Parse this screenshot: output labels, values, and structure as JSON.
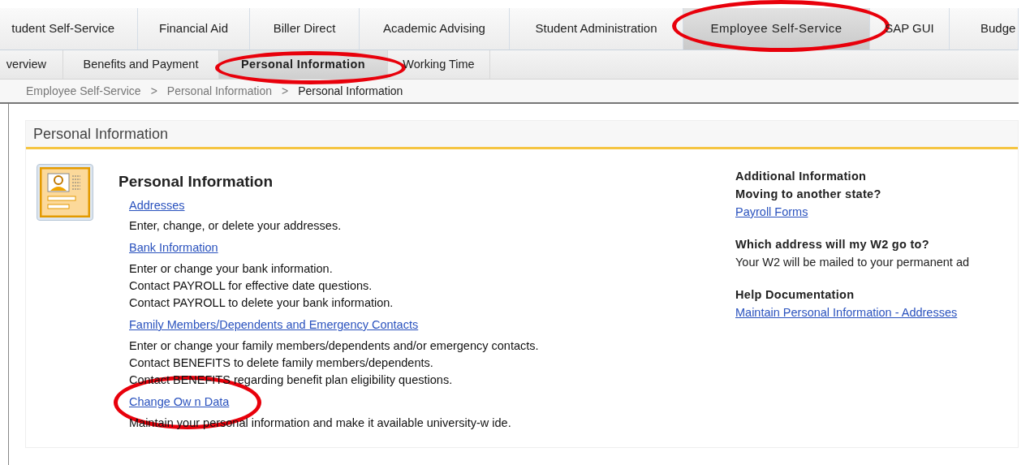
{
  "top_tabs": [
    {
      "label": "tudent Self-Service",
      "selected": false,
      "circled": false
    },
    {
      "label": "Financial Aid",
      "selected": false,
      "circled": false
    },
    {
      "label": "Biller Direct",
      "selected": false,
      "circled": false
    },
    {
      "label": "Academic Advising",
      "selected": false,
      "circled": false
    },
    {
      "label": "Student Administration",
      "selected": false,
      "circled": false
    },
    {
      "label": "Employee Self-Service",
      "selected": true,
      "circled": true
    },
    {
      "label": "SAP GUI",
      "selected": false,
      "circled": false
    },
    {
      "label": "Budge",
      "selected": false,
      "circled": false
    }
  ],
  "sub_tabs": [
    {
      "label": "verview",
      "selected": false,
      "circled": false
    },
    {
      "label": "Benefits and Payment",
      "selected": false,
      "circled": false
    },
    {
      "label": "Personal Information",
      "selected": true,
      "circled": true
    },
    {
      "label": "Working Time",
      "selected": false,
      "circled": false
    }
  ],
  "breadcrumb": [
    "Employee Self-Service",
    "Personal Information",
    "Personal Information"
  ],
  "breadcrumb_separator": ">",
  "panel": {
    "title": "Personal Information",
    "section_title": "Personal Information",
    "links": [
      {
        "label": "Addresses",
        "circled": false,
        "lines": [
          "Enter, change, or delete your addresses."
        ]
      },
      {
        "label": "Bank Information",
        "circled": false,
        "lines": [
          "Enter or change your bank information.",
          "Contact PAYROLL for effective date questions.",
          "Contact PAYROLL to delete your bank information."
        ]
      },
      {
        "label": "Family Members/Dependents and Emergency Contacts",
        "circled": false,
        "lines": [
          "Enter or change your family members/dependents and/or emergency contacts.",
          "Contact BENEFITS to delete family members/dependents.",
          "Contact BENEFITS regarding benefit plan eligibility questions."
        ]
      },
      {
        "label": "Change Ow n Data",
        "circled": true,
        "lines": [
          "Maintain your personal information and make it available university-w ide."
        ]
      }
    ],
    "side": [
      {
        "kind": "heading",
        "text": "Additional Information"
      },
      {
        "kind": "heading",
        "text": "Moving to another state?"
      },
      {
        "kind": "link",
        "text": "Payroll Forms"
      },
      {
        "kind": "gap"
      },
      {
        "kind": "heading",
        "text": "Which address will my W2 go to?"
      },
      {
        "kind": "text",
        "text": "Your W2 will be mailed to your permanent ad"
      },
      {
        "kind": "gap"
      },
      {
        "kind": "heading",
        "text": "Help Documentation"
      },
      {
        "kind": "link",
        "text": "Maintain Personal Information - Addresses"
      }
    ]
  }
}
